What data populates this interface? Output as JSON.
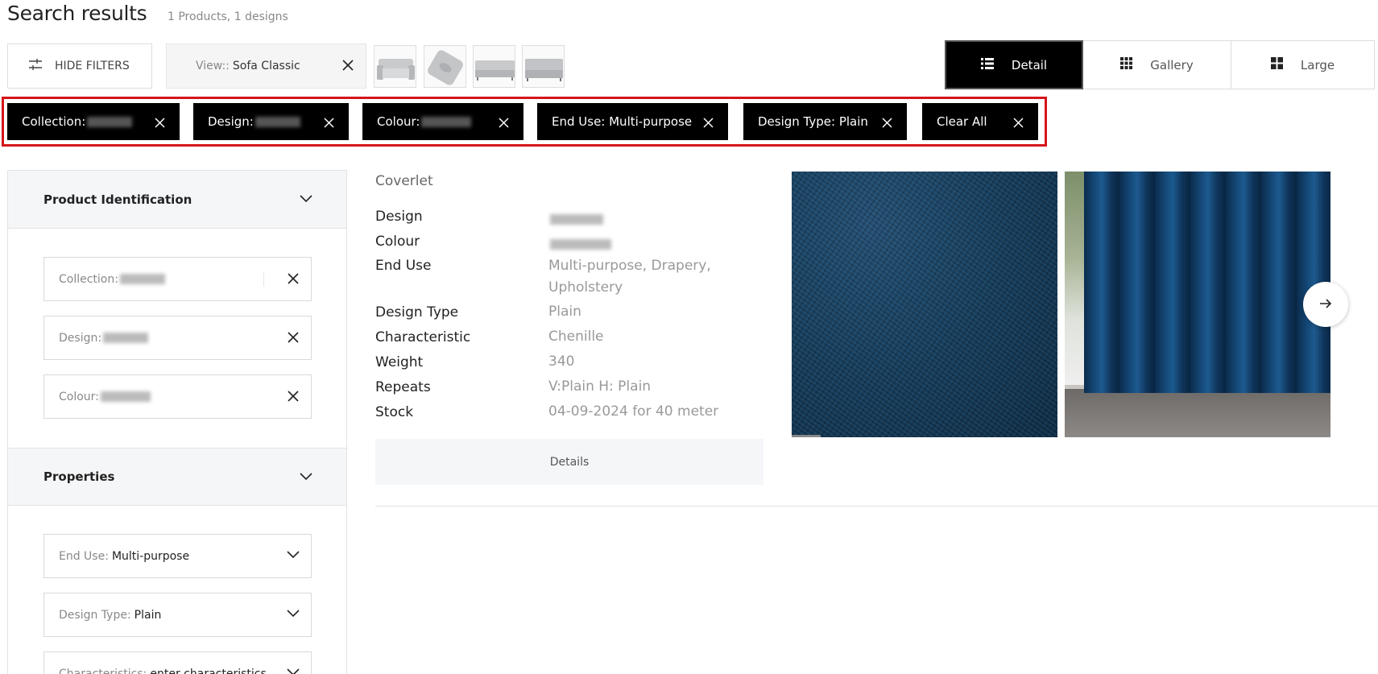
{
  "header": {
    "title": "Search results",
    "subtitle": "1 Products, 1 designs"
  },
  "toolbar": {
    "hide_filters_label": "HIDE FILTERS",
    "view_prefix": "View::",
    "view_value": "Sofa Classic",
    "view_modes": [
      {
        "label": "Detail",
        "active": true
      },
      {
        "label": "Gallery",
        "active": false
      },
      {
        "label": "Large",
        "active": false
      }
    ]
  },
  "active_filters": [
    {
      "label": "Collection:"
    },
    {
      "label": "Design:"
    },
    {
      "label": "Colour:"
    },
    {
      "label": "End Use: Multi-purpose"
    },
    {
      "label": "Design Type: Plain"
    },
    {
      "label": "Clear All"
    }
  ],
  "sidebar": {
    "product_identification": {
      "title": "Product Identification",
      "fields": [
        {
          "label": "Collection:"
        },
        {
          "label": "Design:"
        },
        {
          "label": "Colour:"
        }
      ]
    },
    "properties": {
      "title": "Properties",
      "fields": [
        {
          "label": "End Use:",
          "value": "Multi-purpose"
        },
        {
          "label": "Design Type:",
          "value": "Plain"
        },
        {
          "label": "Characteristics:",
          "value": "enter characteristics"
        }
      ]
    }
  },
  "product": {
    "name": "Coverlet",
    "specs": [
      {
        "label": "Design",
        "value": ""
      },
      {
        "label": "Colour",
        "value": ""
      },
      {
        "label": "End Use",
        "value": "Multi-purpose, Drapery, Upholstery"
      },
      {
        "label": "Design Type",
        "value": "Plain"
      },
      {
        "label": "Characteristic",
        "value": "Chenille"
      },
      {
        "label": "Weight",
        "value": "340"
      },
      {
        "label": "Repeats",
        "value": "V:Plain H: Plain"
      },
      {
        "label": "Stock",
        "value": "04-09-2024 for 40 meter"
      }
    ],
    "details_label": "Details"
  }
}
